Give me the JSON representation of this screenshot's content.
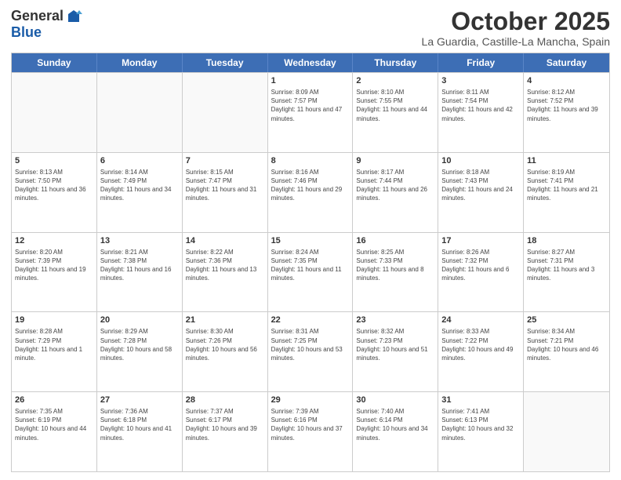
{
  "header": {
    "logo_line1": "General",
    "logo_line2": "Blue",
    "month": "October 2025",
    "location": "La Guardia, Castille-La Mancha, Spain"
  },
  "weekdays": [
    "Sunday",
    "Monday",
    "Tuesday",
    "Wednesday",
    "Thursday",
    "Friday",
    "Saturday"
  ],
  "weeks": [
    [
      {
        "day": "",
        "info": ""
      },
      {
        "day": "",
        "info": ""
      },
      {
        "day": "",
        "info": ""
      },
      {
        "day": "1",
        "info": "Sunrise: 8:09 AM\nSunset: 7:57 PM\nDaylight: 11 hours and 47 minutes."
      },
      {
        "day": "2",
        "info": "Sunrise: 8:10 AM\nSunset: 7:55 PM\nDaylight: 11 hours and 44 minutes."
      },
      {
        "day": "3",
        "info": "Sunrise: 8:11 AM\nSunset: 7:54 PM\nDaylight: 11 hours and 42 minutes."
      },
      {
        "day": "4",
        "info": "Sunrise: 8:12 AM\nSunset: 7:52 PM\nDaylight: 11 hours and 39 minutes."
      }
    ],
    [
      {
        "day": "5",
        "info": "Sunrise: 8:13 AM\nSunset: 7:50 PM\nDaylight: 11 hours and 36 minutes."
      },
      {
        "day": "6",
        "info": "Sunrise: 8:14 AM\nSunset: 7:49 PM\nDaylight: 11 hours and 34 minutes."
      },
      {
        "day": "7",
        "info": "Sunrise: 8:15 AM\nSunset: 7:47 PM\nDaylight: 11 hours and 31 minutes."
      },
      {
        "day": "8",
        "info": "Sunrise: 8:16 AM\nSunset: 7:46 PM\nDaylight: 11 hours and 29 minutes."
      },
      {
        "day": "9",
        "info": "Sunrise: 8:17 AM\nSunset: 7:44 PM\nDaylight: 11 hours and 26 minutes."
      },
      {
        "day": "10",
        "info": "Sunrise: 8:18 AM\nSunset: 7:43 PM\nDaylight: 11 hours and 24 minutes."
      },
      {
        "day": "11",
        "info": "Sunrise: 8:19 AM\nSunset: 7:41 PM\nDaylight: 11 hours and 21 minutes."
      }
    ],
    [
      {
        "day": "12",
        "info": "Sunrise: 8:20 AM\nSunset: 7:39 PM\nDaylight: 11 hours and 19 minutes."
      },
      {
        "day": "13",
        "info": "Sunrise: 8:21 AM\nSunset: 7:38 PM\nDaylight: 11 hours and 16 minutes."
      },
      {
        "day": "14",
        "info": "Sunrise: 8:22 AM\nSunset: 7:36 PM\nDaylight: 11 hours and 13 minutes."
      },
      {
        "day": "15",
        "info": "Sunrise: 8:24 AM\nSunset: 7:35 PM\nDaylight: 11 hours and 11 minutes."
      },
      {
        "day": "16",
        "info": "Sunrise: 8:25 AM\nSunset: 7:33 PM\nDaylight: 11 hours and 8 minutes."
      },
      {
        "day": "17",
        "info": "Sunrise: 8:26 AM\nSunset: 7:32 PM\nDaylight: 11 hours and 6 minutes."
      },
      {
        "day": "18",
        "info": "Sunrise: 8:27 AM\nSunset: 7:31 PM\nDaylight: 11 hours and 3 minutes."
      }
    ],
    [
      {
        "day": "19",
        "info": "Sunrise: 8:28 AM\nSunset: 7:29 PM\nDaylight: 11 hours and 1 minute."
      },
      {
        "day": "20",
        "info": "Sunrise: 8:29 AM\nSunset: 7:28 PM\nDaylight: 10 hours and 58 minutes."
      },
      {
        "day": "21",
        "info": "Sunrise: 8:30 AM\nSunset: 7:26 PM\nDaylight: 10 hours and 56 minutes."
      },
      {
        "day": "22",
        "info": "Sunrise: 8:31 AM\nSunset: 7:25 PM\nDaylight: 10 hours and 53 minutes."
      },
      {
        "day": "23",
        "info": "Sunrise: 8:32 AM\nSunset: 7:23 PM\nDaylight: 10 hours and 51 minutes."
      },
      {
        "day": "24",
        "info": "Sunrise: 8:33 AM\nSunset: 7:22 PM\nDaylight: 10 hours and 49 minutes."
      },
      {
        "day": "25",
        "info": "Sunrise: 8:34 AM\nSunset: 7:21 PM\nDaylight: 10 hours and 46 minutes."
      }
    ],
    [
      {
        "day": "26",
        "info": "Sunrise: 7:35 AM\nSunset: 6:19 PM\nDaylight: 10 hours and 44 minutes."
      },
      {
        "day": "27",
        "info": "Sunrise: 7:36 AM\nSunset: 6:18 PM\nDaylight: 10 hours and 41 minutes."
      },
      {
        "day": "28",
        "info": "Sunrise: 7:37 AM\nSunset: 6:17 PM\nDaylight: 10 hours and 39 minutes."
      },
      {
        "day": "29",
        "info": "Sunrise: 7:39 AM\nSunset: 6:16 PM\nDaylight: 10 hours and 37 minutes."
      },
      {
        "day": "30",
        "info": "Sunrise: 7:40 AM\nSunset: 6:14 PM\nDaylight: 10 hours and 34 minutes."
      },
      {
        "day": "31",
        "info": "Sunrise: 7:41 AM\nSunset: 6:13 PM\nDaylight: 10 hours and 32 minutes."
      },
      {
        "day": "",
        "info": ""
      }
    ]
  ]
}
